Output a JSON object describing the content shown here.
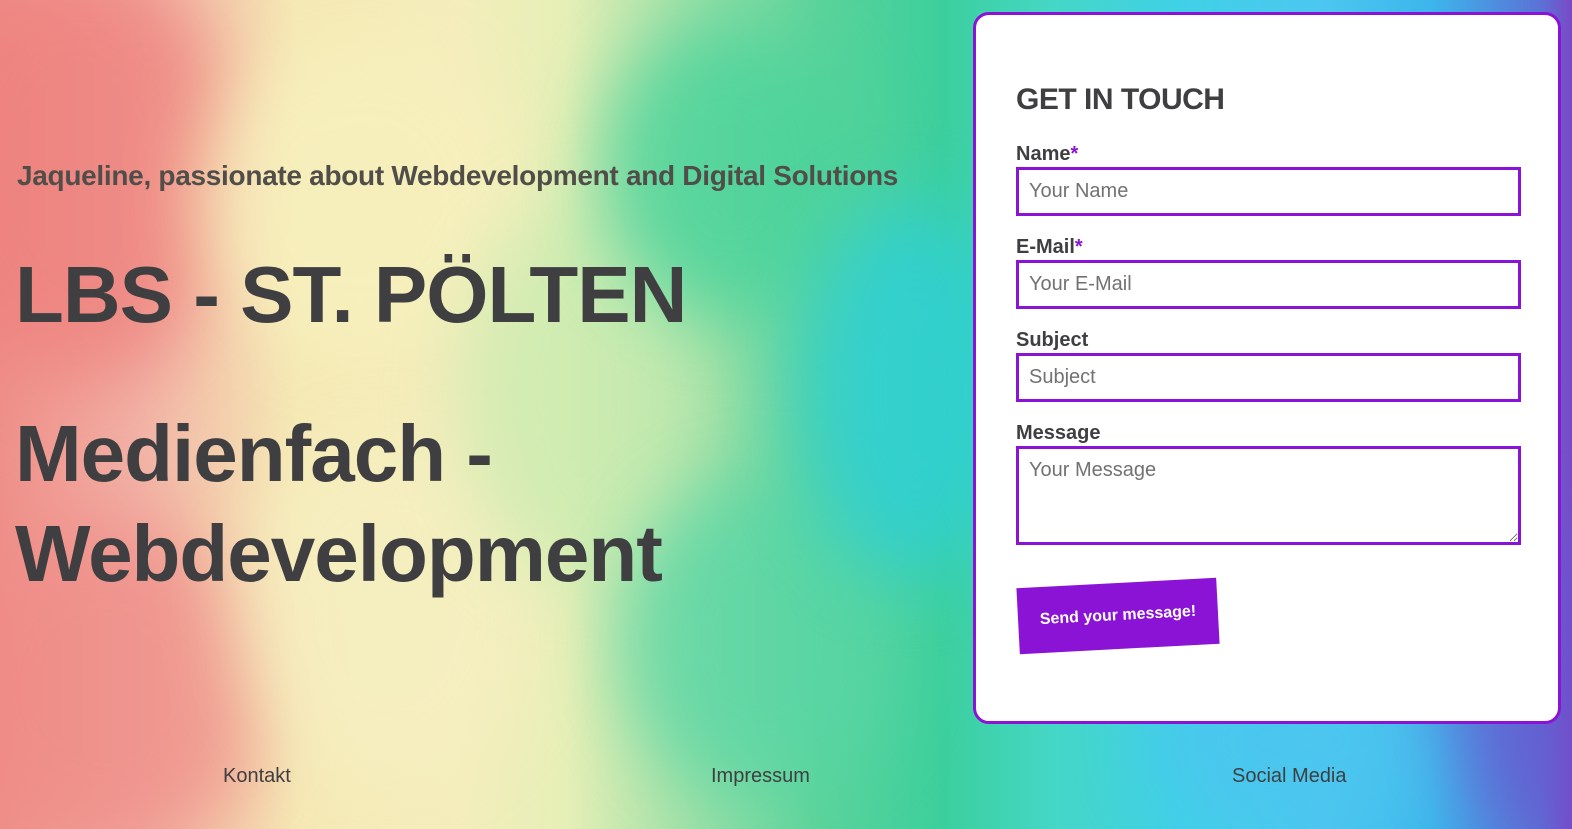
{
  "hero": {
    "subtitle": "Jaqueline, passionate about Webdevelopment and Digital Solutions",
    "title": "LBS - ST. PÖLTEN",
    "heading_line1": "Medienfach -",
    "heading_line2": "Webdevelopment"
  },
  "contact_form": {
    "title": "GET IN TOUCH",
    "name_label": "Name",
    "name_required": "*",
    "name_placeholder": "Your Name",
    "email_label": "E-Mail",
    "email_required": "*",
    "email_placeholder": "Your E-Mail",
    "subject_label": "Subject",
    "subject_placeholder": "Subject",
    "message_label": "Message",
    "message_placeholder": "Your Message",
    "submit_label": "Send your message!"
  },
  "footer": {
    "links": [
      "Kontakt",
      "Impressum",
      "Social Media"
    ]
  },
  "colors": {
    "accent": "#8a13d6",
    "text": "#3f3f42"
  }
}
